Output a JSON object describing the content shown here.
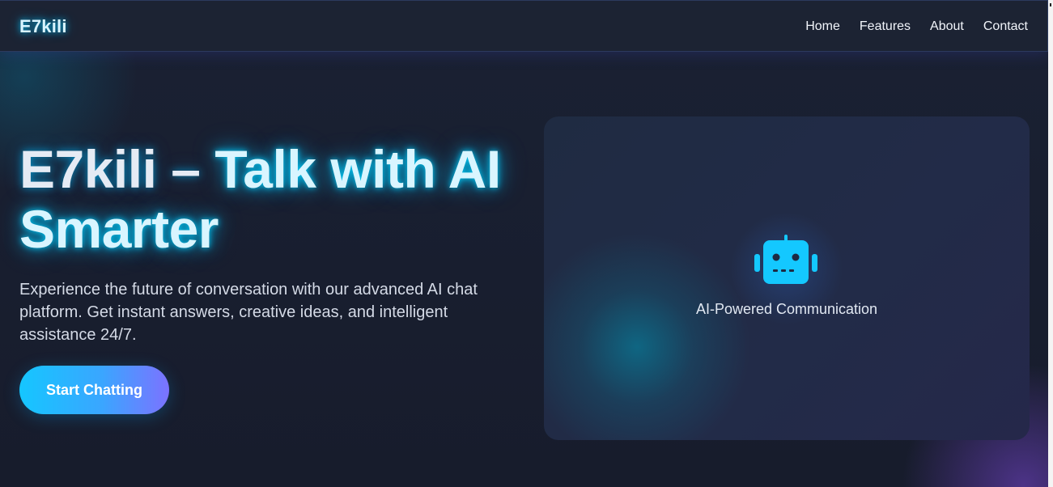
{
  "nav": {
    "brand": "E7kili",
    "links": [
      "Home",
      "Features",
      "About",
      "Contact"
    ]
  },
  "hero": {
    "title_part1": "E7kili – ",
    "title_part2": "Talk with AI Smarter",
    "description": "Experience the future of conversation with our advanced AI chat platform. Get instant answers, creative ideas, and intelligent assistance 24/7.",
    "cta_label": "Start Chatting"
  },
  "card": {
    "icon": "robot-icon",
    "caption": "AI-Powered Communication"
  },
  "colors": {
    "accent_cyan": "#15c6ff",
    "accent_purple": "#7c72ff",
    "background": "#171d2e"
  }
}
